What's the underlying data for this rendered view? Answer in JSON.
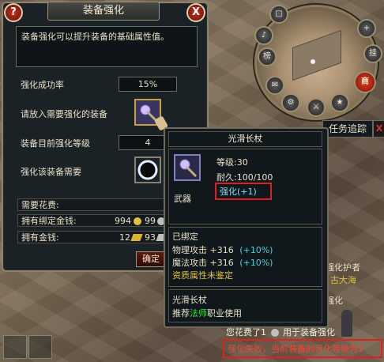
{
  "enhance_panel": {
    "title": "装备强化",
    "help_label": "?",
    "close_label": "X",
    "description": "装备强化可以提升装备的基础属性值。",
    "success_rate_label": "强化成功率",
    "success_rate_value": "15%",
    "place_item_label": "请放入需要强化的装备",
    "current_level_label": "装备目前强化等级",
    "current_level_value": "4",
    "requirement_label": "强化该装备需要",
    "cost_label": "需要花费:",
    "bound_money_label": "拥有绑定金钱:",
    "bound_money_value": "994",
    "bound_money_value2": "99",
    "money_label": "拥有金钱:",
    "money_value": "12",
    "money_value2": "93",
    "confirm_label": "确定"
  },
  "tooltip": {
    "item_name": "光滑长杖",
    "level": "等级:30",
    "durability": "耐久:100/100",
    "enhance": "强化(+1)",
    "type": "武器",
    "bound": "已绑定",
    "attr1_name": "物理攻击 +316",
    "attr1_bonus": "(+10%)",
    "attr2_name": "魔法攻击 +316",
    "attr2_bonus": "(+10%)",
    "unidentified": "资质属性未鉴定",
    "footer_name": "光滑长杖",
    "recommend_prefix": "推荐",
    "recommend_class": "法师",
    "recommend_suffix": "职业使用"
  },
  "quest_tracker": {
    "label": "任务追踪",
    "close_label": "X"
  },
  "minimap_buttons": [
    "榜",
    "商",
    "挂"
  ],
  "world_text": {
    "npc_title": "强化护者",
    "npc_name": "古大海",
    "npc_label": "强化"
  },
  "chat": {
    "line1": "您花费了1",
    "line1b": "用于装备强化",
    "line2": "强化失败，当前装备的强化等级为1"
  },
  "colors": {
    "accent_red": "#e02020",
    "bonus_cyan": "#3fd0e0",
    "class_green": "#40e040",
    "enhance_cyan": "#6fe0ff",
    "gold": "#e0c040"
  }
}
